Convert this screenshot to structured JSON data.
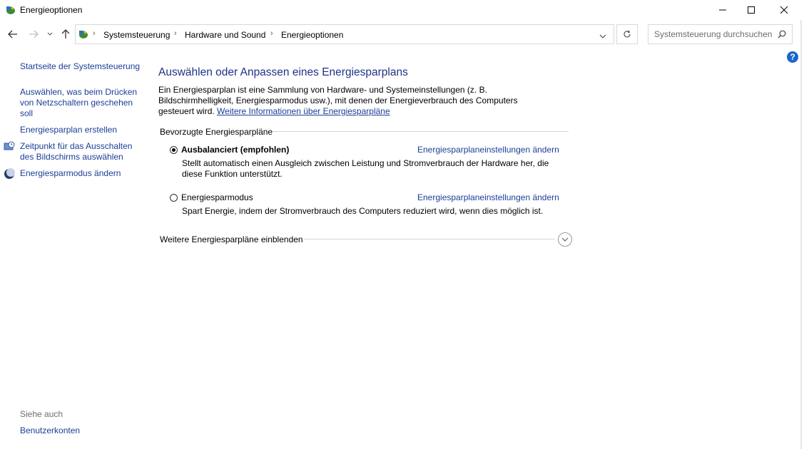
{
  "window": {
    "title": "Energieoptionen",
    "controls": {
      "minimize": "minimize-icon",
      "maximize": "maximize-icon",
      "close": "close-icon"
    }
  },
  "nav": {
    "breadcrumb": [
      "Systemsteuerung",
      "Hardware und Sound",
      "Energieoptionen"
    ],
    "search_placeholder": "Systemsteuerung durchsuchen"
  },
  "sidebar": {
    "home_link": "Startseite der Systemsteuerung",
    "tasks": [
      "Auswählen, was beim Drücken von Netzschaltern geschehen soll",
      "Energiesparplan erstellen",
      "Zeitpunkt für das Ausschalten des Bildschirms auswählen",
      "Energiesparmodus ändern"
    ],
    "see_also_label": "Siehe auch",
    "see_also": [
      "Benutzerkonten"
    ]
  },
  "main": {
    "heading": "Auswählen oder Anpassen eines Energiesparplans",
    "description": "Ein Energiesparplan ist eine Sammlung von Hardware- und Systemeinstellungen (z. B. Bildschirmhelligkeit, Energiesparmodus usw.), mit denen der Energieverbrauch des Computers gesteuert wird.",
    "more_info_link": "Weitere Informationen über Energiesparpläne",
    "preferred_label": "Bevorzugte Energiesparpläne",
    "plans": [
      {
        "name": "Ausbalanciert (empfohlen)",
        "selected": true,
        "link": "Energiesparplaneinstellungen ändern",
        "description": "Stellt automatisch einen Ausgleich zwischen Leistung und Stromverbrauch der Hardware her, die diese Funktion unterstützt."
      },
      {
        "name": "Energiesparmodus",
        "selected": false,
        "link": "Energiesparplaneinstellungen ändern",
        "description": "Spart Energie, indem der Stromverbrauch des Computers reduziert wird, wenn dies möglich ist."
      }
    ],
    "more_plans_label": "Weitere Energiesparpläne einblenden"
  }
}
